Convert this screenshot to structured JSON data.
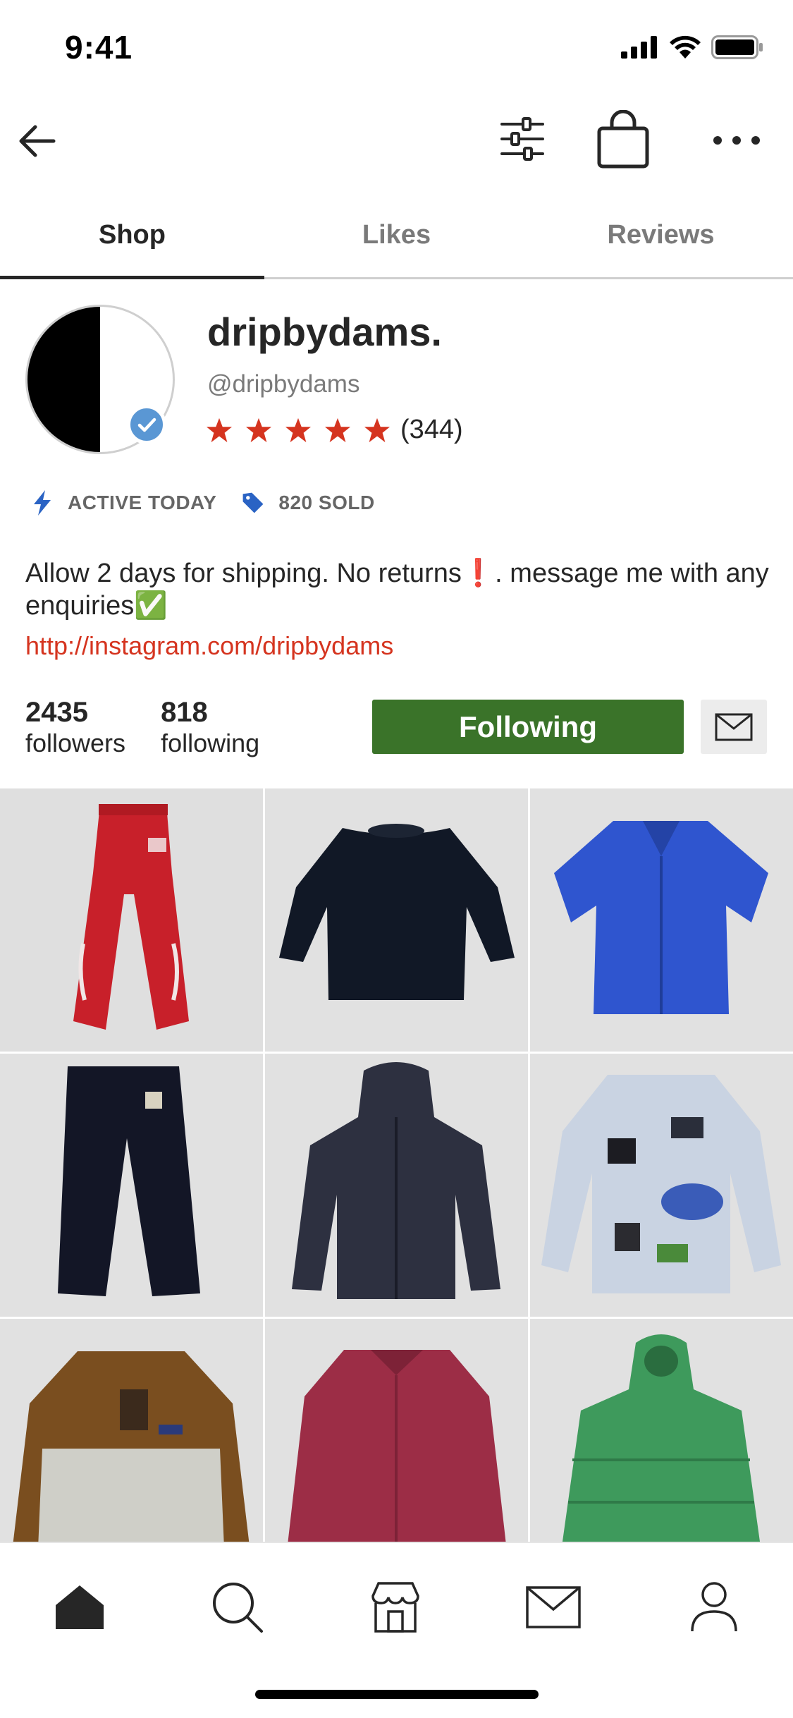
{
  "status_bar": {
    "time": "9:41"
  },
  "nav": {
    "back_icon": "arrow-left-icon",
    "filter_icon": "sliders-icon",
    "bag_icon": "shopping-bag-icon",
    "more_icon": "more-horizontal-icon"
  },
  "tabs": [
    {
      "label": "Shop",
      "active": true
    },
    {
      "label": "Likes",
      "active": false
    },
    {
      "label": "Reviews",
      "active": false
    }
  ],
  "profile": {
    "name": "dripbydams.",
    "handle": "@dripbydams",
    "rating_stars": 5,
    "review_count": "(344)",
    "star_color": "#d5341f",
    "verified": true
  },
  "badges": {
    "active": "ACTIVE TODAY",
    "sold": "820 SOLD"
  },
  "bio": {
    "text": "Allow 2 days for shipping. No returns❗️. message me with any enquiries✅",
    "link": "http://instagram.com/dripbydams"
  },
  "stats": {
    "followers_count": "2435",
    "followers_label": "followers",
    "following_count": "818",
    "following_label": "following"
  },
  "actions": {
    "follow_label": "Following",
    "follow_color": "#3a7329"
  },
  "listings": [
    {
      "item": "red sweatpants"
    },
    {
      "item": "navy crewneck sweatshirt"
    },
    {
      "item": "blue short sleeve shirt"
    },
    {
      "item": "black work pants"
    },
    {
      "item": "navy hooded jacket"
    },
    {
      "item": "printed button-up shirt"
    },
    {
      "item": "brown fleece pullover"
    },
    {
      "item": "maroon overshirt"
    },
    {
      "item": "green puffer jacket"
    }
  ],
  "bottom_tabs": [
    "home-icon",
    "search-icon",
    "shop-icon",
    "inbox-icon",
    "profile-icon"
  ]
}
